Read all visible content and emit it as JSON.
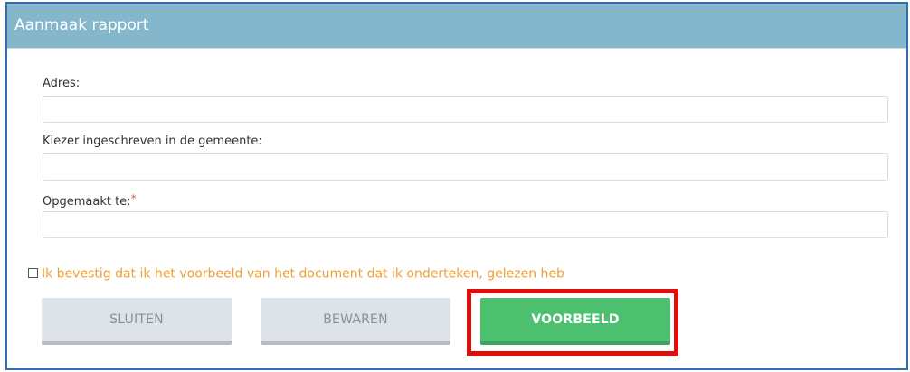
{
  "dialog": {
    "title": "Aanmaak rapport"
  },
  "form": {
    "address": {
      "label": "Adres:",
      "value": ""
    },
    "voter_registered": {
      "label": "Kiezer ingeschreven in de gemeente:",
      "value": ""
    },
    "made_at": {
      "label": "Opgemaakt te:",
      "required_mark": "*",
      "value": ""
    }
  },
  "confirm": {
    "text": "Ik bevestig dat ik het voorbeeld van het document dat ik onderteken, gelezen heb",
    "checked": false
  },
  "buttons": {
    "close": "SLUITEN",
    "save": "BEWAREN",
    "preview": "VOORBEELD"
  },
  "colors": {
    "header_bg": "#84b7cb",
    "confirm_text": "#f0a030",
    "preview_button": "#4cc06f",
    "highlight": "#e00d0d",
    "required_mark": "#e05d4a"
  }
}
